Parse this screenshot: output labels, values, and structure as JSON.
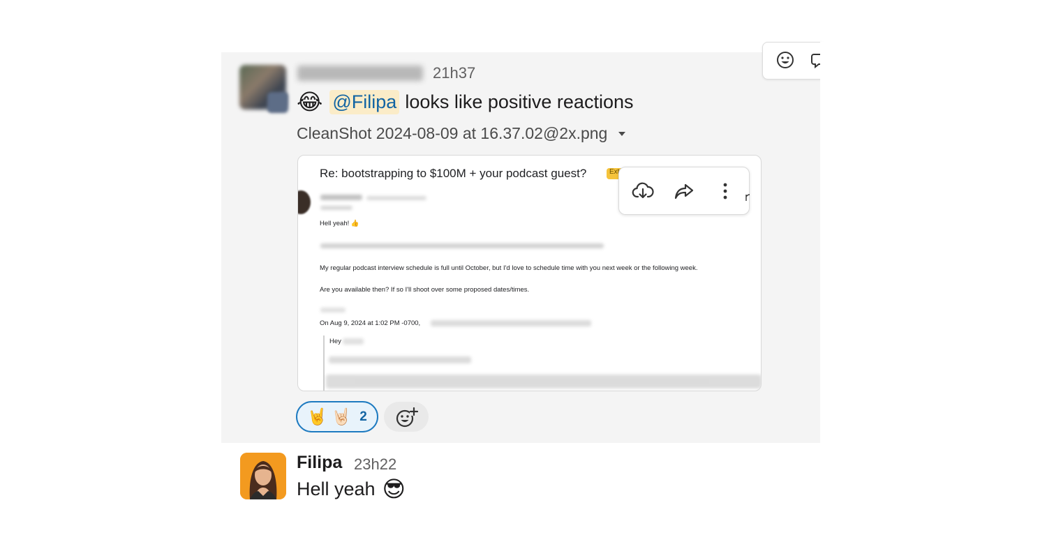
{
  "messages": [
    {
      "sender": "",
      "time": "21h37",
      "emoji": "😂",
      "mention": "@Filipa",
      "text": "looks like positive reactions",
      "attachment": {
        "filename": "CleanShot 2024-08-09 at 16.37.02@2x.png",
        "preview": {
          "subject": "Re: bootstrapping to $100M + your podcast guest?",
          "badge": "Ext",
          "greeting": "Hell yeah! 👍",
          "line1": "My regular podcast interview schedule is full until October, but I'd love to schedule time with you next week or the following week.",
          "line2": "Are you available then? If so I'll shoot over some proposed dates/times.",
          "quote_header": "On Aug 9, 2024 at 1:02 PM -0700,",
          "quote_greeting": "Hey"
        }
      },
      "reactions": [
        {
          "emojis": [
            "🤘",
            "🤘🏻"
          ],
          "count": "2"
        }
      ]
    },
    {
      "sender": "Filipa",
      "time": "23h22",
      "text": "Hell yeah",
      "emoji": "😎"
    }
  ],
  "icons": {
    "download": "cloud-download-icon",
    "share": "share-icon",
    "more": "more-vertical-icon",
    "add_reaction": "add-reaction-icon",
    "emoji": "emoji-icon",
    "caret": "caret-down-icon"
  },
  "colors": {
    "mention_bg": "#fbecc8",
    "mention_text": "#1264a3",
    "reaction_border": "#1d7ac0",
    "reaction_bg": "#e8f3fb",
    "hover_bg": "#f4f4f4",
    "avatar_bg": "#f39a1f"
  }
}
